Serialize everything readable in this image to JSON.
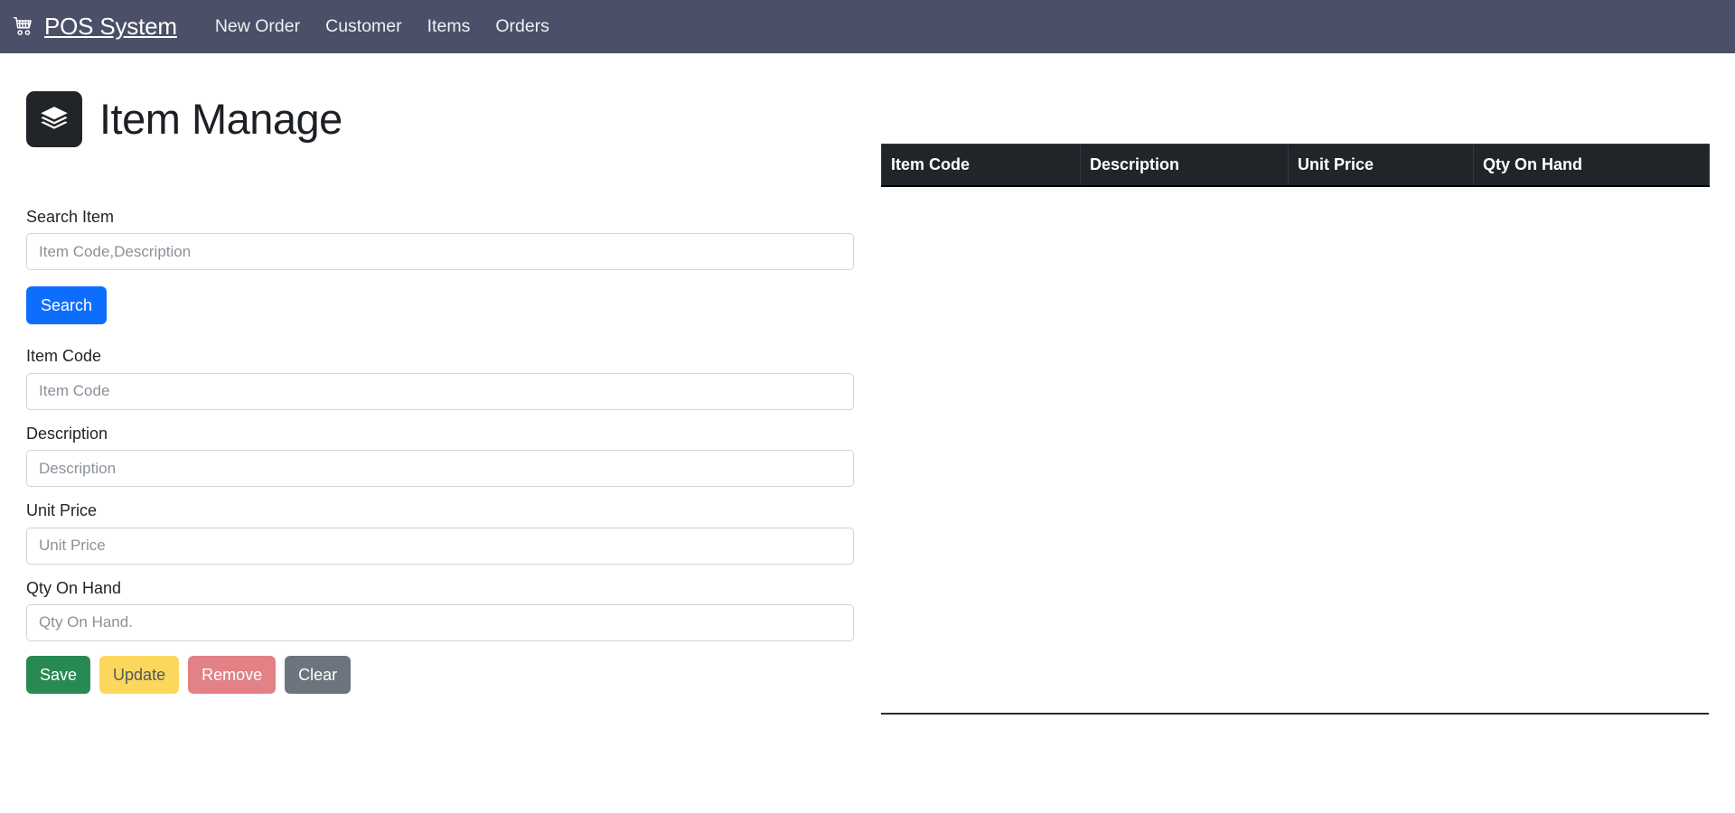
{
  "navbar": {
    "brand": "POS System",
    "brand_icon": "shopping-cart-icon",
    "background_color": "#4b5068",
    "links": [
      {
        "label": "New Order"
      },
      {
        "label": "Customer"
      },
      {
        "label": "Items"
      },
      {
        "label": "Orders"
      }
    ]
  },
  "header": {
    "title": "Item Manage",
    "icon": "layers-stack-icon",
    "icon_background": "#212529"
  },
  "form": {
    "search": {
      "label": "Search Item",
      "placeholder": "Item Code,Description",
      "value": "",
      "button_label": "Search",
      "button_color": "#0d6efd"
    },
    "fields": [
      {
        "label": "Item Code",
        "placeholder": "Item Code",
        "value": ""
      },
      {
        "label": "Description",
        "placeholder": "Description",
        "value": ""
      },
      {
        "label": "Unit Price",
        "placeholder": "Unit Price",
        "value": ""
      },
      {
        "label": "Qty On Hand",
        "placeholder": "Qty On Hand.",
        "value": ""
      }
    ],
    "actions": [
      {
        "label": "Save",
        "color": "#288a52",
        "text_color": "#ffffff"
      },
      {
        "label": "Update",
        "color": "#fbd85d",
        "text_color": "#54585c"
      },
      {
        "label": "Remove",
        "color": "#e28186",
        "text_color": "#ffffff"
      },
      {
        "label": "Clear",
        "color": "#6c757d",
        "text_color": "#ffffff"
      }
    ]
  },
  "table": {
    "header_background": "#212529",
    "columns": [
      "Item Code",
      "Description",
      "Unit Price",
      "Qty On Hand"
    ],
    "rows": []
  }
}
